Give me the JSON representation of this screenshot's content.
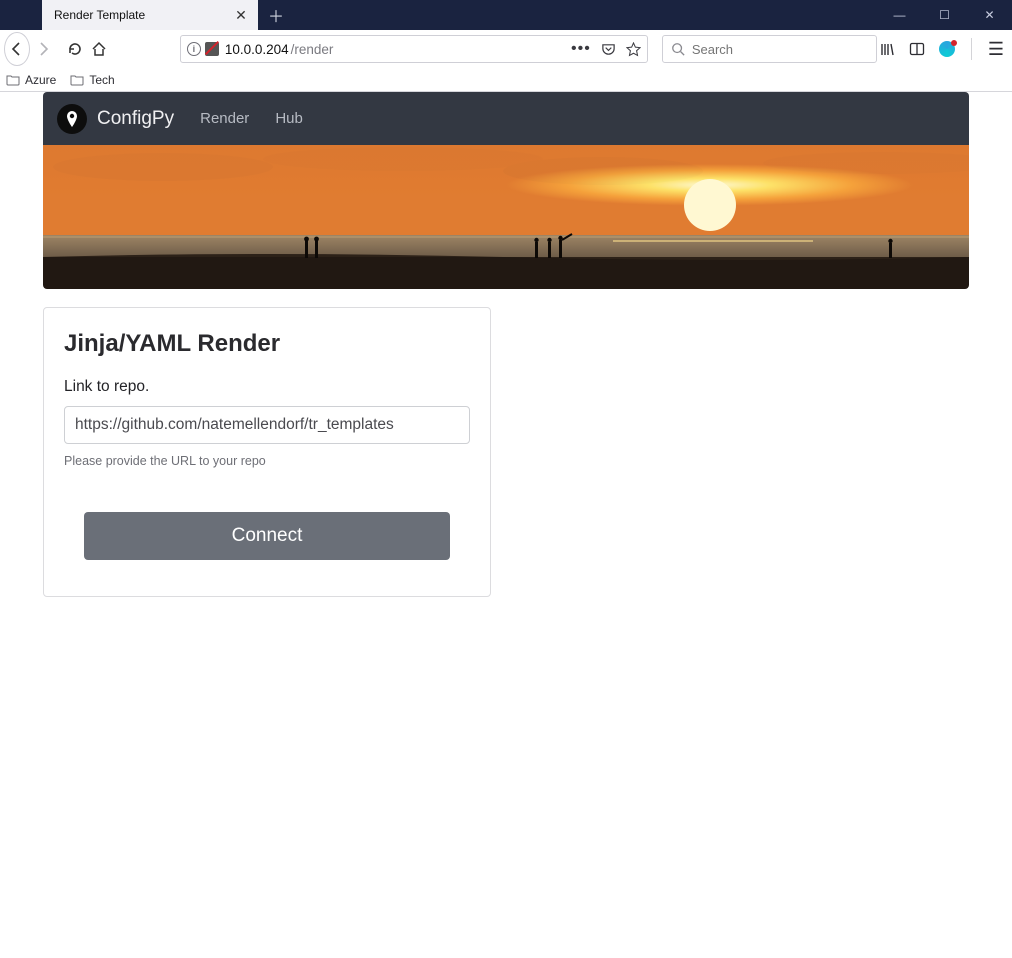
{
  "browser": {
    "tab_title": "Render Template",
    "url_host": "10.0.0.204",
    "url_path": "/render",
    "search_placeholder": "Search",
    "bookmarks": [
      "Azure",
      "Tech"
    ]
  },
  "navbar": {
    "brand": "ConfigPy",
    "links": [
      "Render",
      "Hub"
    ]
  },
  "card": {
    "title": "Jinja/YAML Render",
    "label": "Link to repo.",
    "repo_value": "https://github.com/natemellendorf/tr_templates",
    "help": "Please provide the URL to your repo",
    "button": "Connect"
  }
}
